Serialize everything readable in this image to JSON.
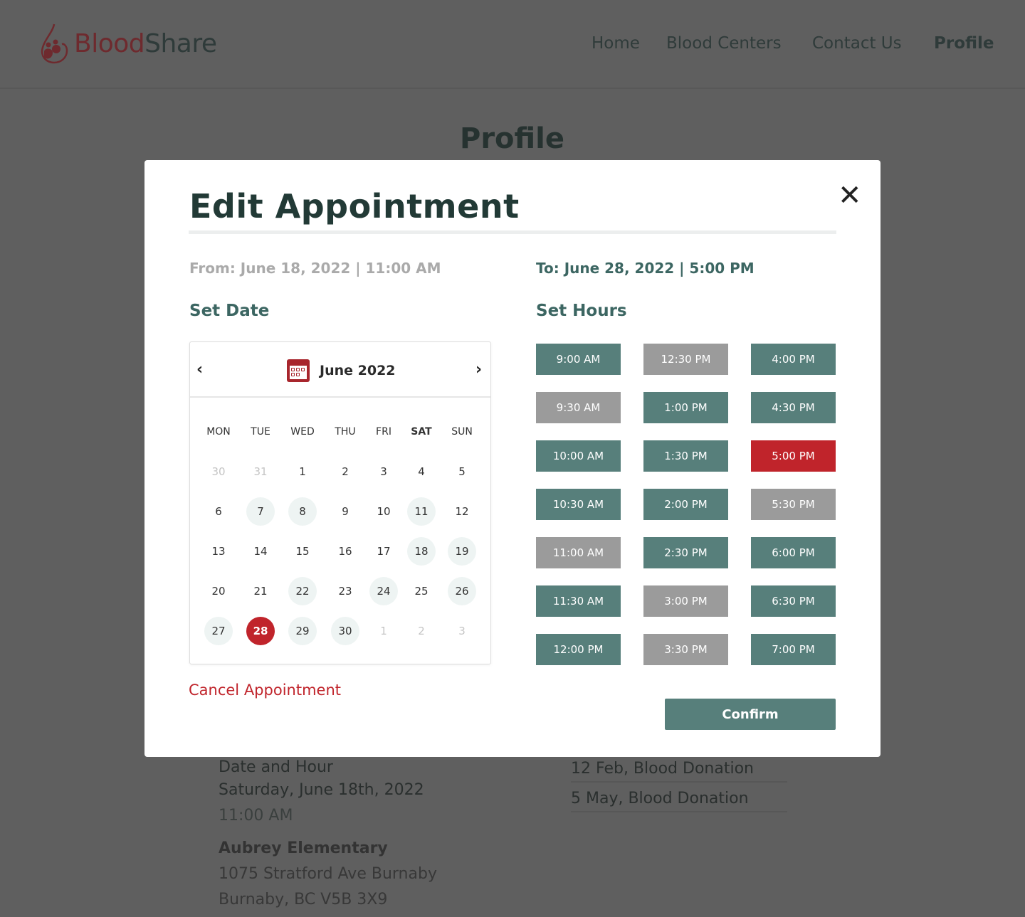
{
  "nav": {
    "logo_blood": "Blood",
    "logo_share": "Share",
    "links": [
      "Home",
      "Blood Centers",
      "Contact Us",
      "Profile"
    ]
  },
  "background": {
    "title": "Profile",
    "date_hour_label": "Date and Hour",
    "date": "Saturday, June 18th, 2022",
    "time": "11:00 AM",
    "location": "Aubrey Elementary",
    "address1": "1075 Stratford Ave Burnaby",
    "address2": "Burnaby, BC V5B 3X9",
    "history": [
      "12 Feb, Blood Donation",
      "5 May, Blood Donation"
    ]
  },
  "modal": {
    "title": "Edit Appointment",
    "from": "From: June 18, 2022 | 11:00 AM",
    "to": "To: June 28, 2022 | 5:00 PM",
    "set_date": "Set Date",
    "set_hours": "Set Hours",
    "cancel": "Cancel Appointment",
    "confirm": "Confirm",
    "calendar": {
      "month": "June 2022",
      "weekdays": [
        "MON",
        "TUE",
        "WED",
        "THU",
        "FRI",
        "SAT",
        "SUN"
      ],
      "bold_weekday": "SAT",
      "weeks": [
        [
          {
            "d": "30",
            "s": "other"
          },
          {
            "d": "31",
            "s": "other"
          },
          {
            "d": "1"
          },
          {
            "d": "2"
          },
          {
            "d": "3"
          },
          {
            "d": "4"
          },
          {
            "d": "5"
          }
        ],
        [
          {
            "d": "6"
          },
          {
            "d": "7",
            "s": "avail"
          },
          {
            "d": "8",
            "s": "avail"
          },
          {
            "d": "9"
          },
          {
            "d": "10"
          },
          {
            "d": "11",
            "s": "avail"
          },
          {
            "d": "12"
          }
        ],
        [
          {
            "d": "13"
          },
          {
            "d": "14"
          },
          {
            "d": "15"
          },
          {
            "d": "16"
          },
          {
            "d": "17"
          },
          {
            "d": "18",
            "s": "avail"
          },
          {
            "d": "19",
            "s": "avail"
          }
        ],
        [
          {
            "d": "20"
          },
          {
            "d": "21"
          },
          {
            "d": "22",
            "s": "avail"
          },
          {
            "d": "23"
          },
          {
            "d": "24",
            "s": "avail"
          },
          {
            "d": "25"
          },
          {
            "d": "26",
            "s": "avail"
          }
        ],
        [
          {
            "d": "27",
            "s": "avail"
          },
          {
            "d": "28",
            "s": "selected"
          },
          {
            "d": "29",
            "s": "avail"
          },
          {
            "d": "30",
            "s": "avail"
          },
          {
            "d": "1",
            "s": "other"
          },
          {
            "d": "2",
            "s": "other"
          },
          {
            "d": "3",
            "s": "other"
          }
        ]
      ]
    },
    "slots": [
      [
        {
          "t": "9:00 AM",
          "s": "available"
        },
        {
          "t": "9:30 AM",
          "s": "unavailable"
        },
        {
          "t": "10:00 AM",
          "s": "available"
        },
        {
          "t": "10:30 AM",
          "s": "available"
        },
        {
          "t": "11:00 AM",
          "s": "unavailable"
        },
        {
          "t": "11:30 AM",
          "s": "available"
        },
        {
          "t": "12:00 PM",
          "s": "available"
        }
      ],
      [
        {
          "t": "12:30 PM",
          "s": "unavailable"
        },
        {
          "t": "1:00 PM",
          "s": "available"
        },
        {
          "t": "1:30 PM",
          "s": "available"
        },
        {
          "t": "2:00 PM",
          "s": "available"
        },
        {
          "t": "2:30 PM",
          "s": "available"
        },
        {
          "t": "3:00 PM",
          "s": "unavailable"
        },
        {
          "t": "3:30 PM",
          "s": "unavailable"
        }
      ],
      [
        {
          "t": "4:00 PM",
          "s": "available"
        },
        {
          "t": "4:30 PM",
          "s": "available"
        },
        {
          "t": "5:00 PM",
          "s": "selected"
        },
        {
          "t": "5:30 PM",
          "s": "unavailable"
        },
        {
          "t": "6:00 PM",
          "s": "available"
        },
        {
          "t": "6:30 PM",
          "s": "available"
        },
        {
          "t": "7:00 PM",
          "s": "available"
        }
      ]
    ],
    "colors": {
      "available": "#577f7b",
      "unavailable": "#9b9b9b",
      "selected": "#c0242b"
    }
  }
}
